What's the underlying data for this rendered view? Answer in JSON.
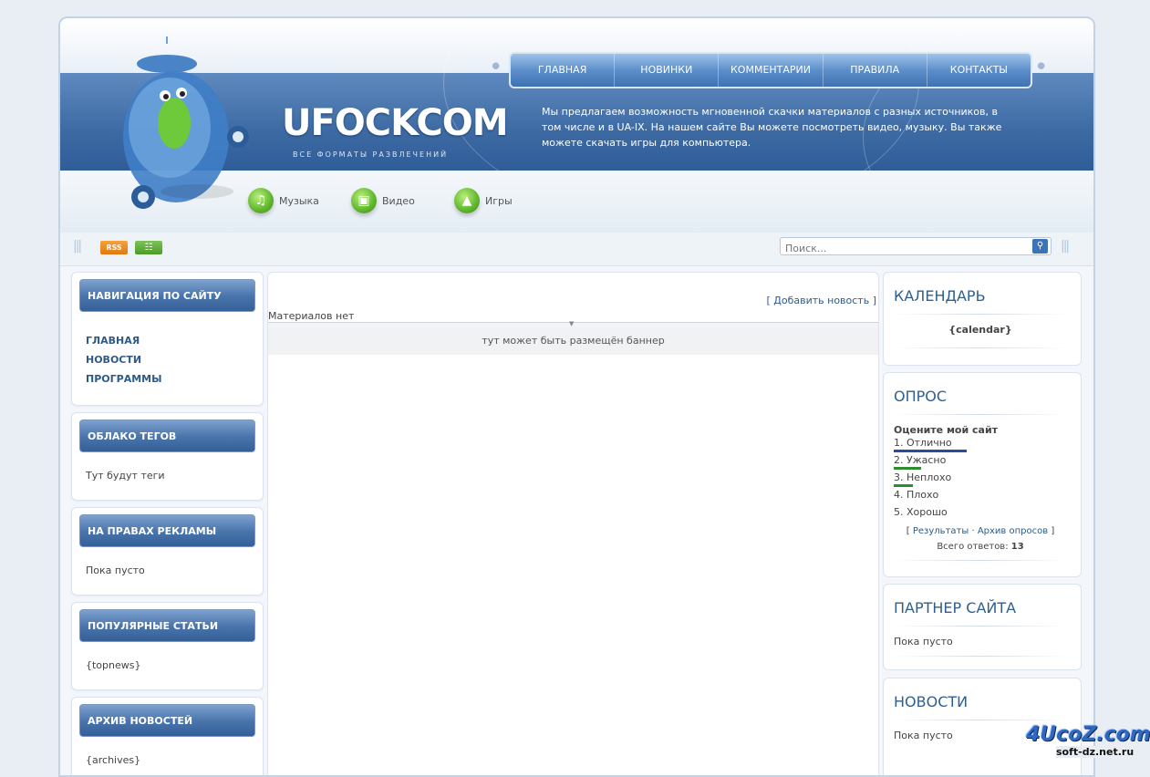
{
  "nav": [
    "ГЛАВНАЯ",
    "НОВИНКИ",
    "КОММЕНТАРИИ",
    "ПРАВИЛА",
    "КОНТАКТЫ"
  ],
  "logo": "UFOCKCOM",
  "slogan": "ВСЕ ФОРМАТЫ РАЗВЛЕЧЕНИЙ",
  "description": "Мы предлагаем возможность мгновенной скачки материалов с разных источников, в том числе и в UA-IX. На нашем сайте Вы можете посмотреть видео, музыку. Вы также можете скачать игры для компьютера.",
  "categories": [
    {
      "label": "Музыка",
      "icon": "music-note-icon"
    },
    {
      "label": "Видео",
      "icon": "video-icon"
    },
    {
      "label": "Игры",
      "icon": "gamepad-icon"
    }
  ],
  "toolbar": {
    "rss": "RSS",
    "search_placeholder": "Поиск..."
  },
  "left": {
    "site_nav": {
      "title": "НАВИГАЦИЯ ПО САЙТУ",
      "items": [
        "ГЛАВНАЯ",
        "НОВОСТИ",
        "ПРОГРАММЫ"
      ]
    },
    "tags": {
      "title": "ОБЛАКО ТЕГОВ",
      "text": "Тут будут теги"
    },
    "ads": {
      "title": "НА ПРАВАХ РЕКЛАМЫ",
      "text": "Пока пусто"
    },
    "popular": {
      "title": "ПОПУЛЯРНЫЕ СТАТЬИ",
      "text": "{topnews}"
    },
    "archive": {
      "title": "АРХИВ НОВОСТЕЙ",
      "text": "{archives}"
    }
  },
  "center": {
    "add_news": "[ Добавить новость ]",
    "no_materials": "Материалов нет",
    "banner": "тут может быть размещён баннер"
  },
  "right": {
    "calendar": {
      "title": "КАЛЕНДАРЬ",
      "text": "{calendar}"
    },
    "poll": {
      "title": "ОПРОС",
      "question": "Оцените мой сайт",
      "options": [
        {
          "label": "1. Отлично",
          "share": 0.42,
          "color": "#2b4c9c"
        },
        {
          "label": "2. Ужасно",
          "share": 0.16,
          "color": "#2e8b2e"
        },
        {
          "label": "3. Неплохо",
          "share": 0.11,
          "color": "#2e8b2e"
        },
        {
          "label": "4. Плохо",
          "share": 0,
          "color": "#2e8b2e"
        },
        {
          "label": "5. Хорошо",
          "share": 0,
          "color": "#2e8b2e"
        }
      ],
      "results": "Результаты",
      "dot": "·",
      "archive": "Архив опросов",
      "lb": "[",
      "rb": "]",
      "total_label": "Всего ответов:",
      "total_value": "13"
    },
    "partner": {
      "title": "ПАРТНЕР САЙТА",
      "text": "Пока пусто"
    },
    "news": {
      "title": "НОВОСТИ",
      "text": "Пока пусто"
    }
  },
  "watermark": {
    "brand": "4UcoZ.com",
    "url": "soft-dz.net.ru"
  }
}
